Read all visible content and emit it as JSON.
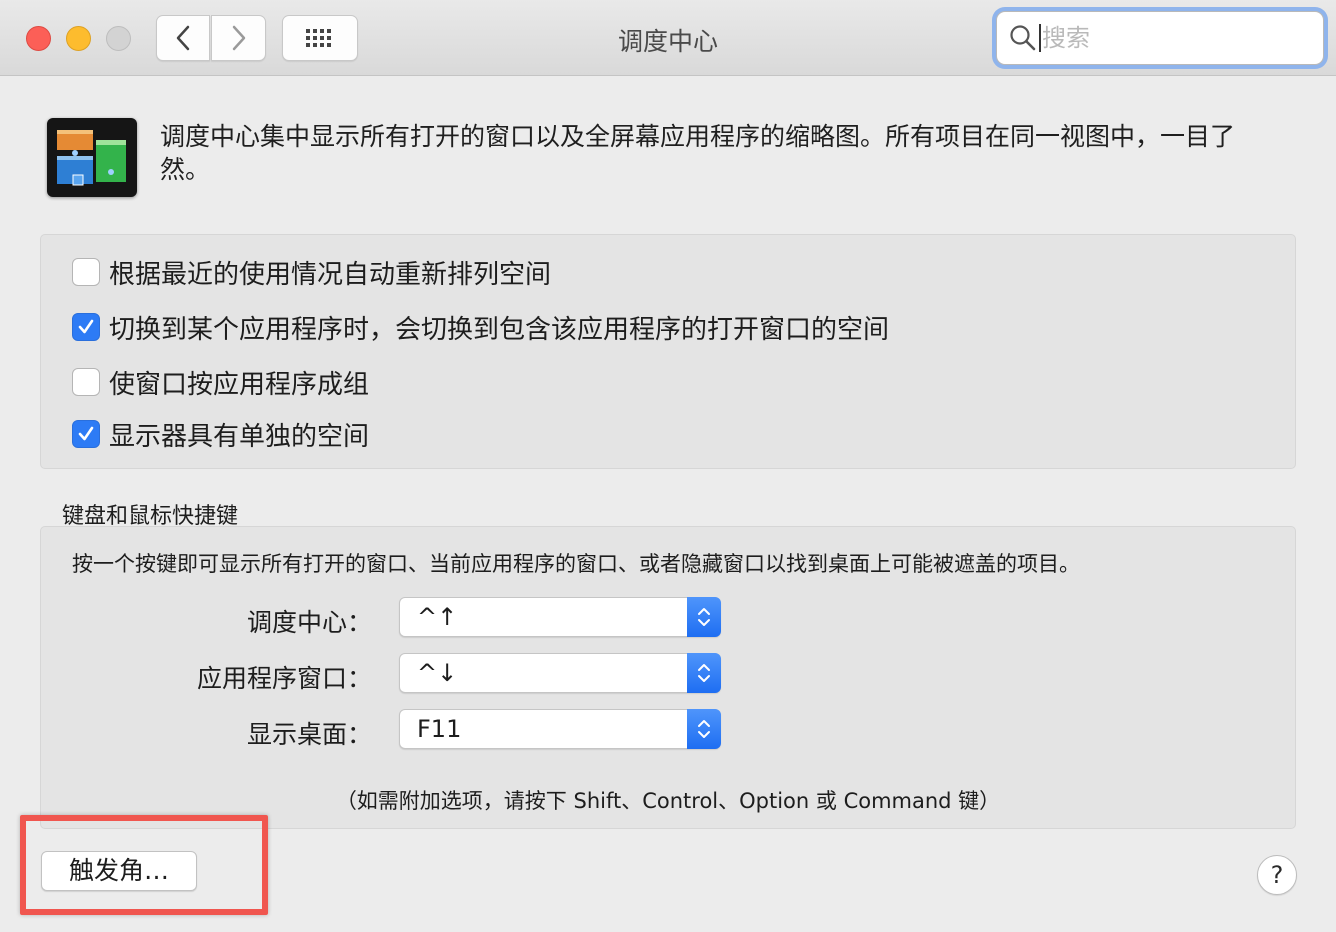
{
  "window": {
    "title": "调度中心",
    "search": {
      "value": "",
      "placeholder": "搜索"
    }
  },
  "header": {
    "description": "调度中心集中显示所有打开的窗口以及全屏幕应用程序的缩略图。所有项目在同一视图中，一目了然。"
  },
  "options": [
    {
      "label": "根据最近的使用情况自动重新排列空间",
      "checked": false
    },
    {
      "label": "切换到某个应用程序时，会切换到包含该应用程序的打开窗口的空间",
      "checked": true
    },
    {
      "label": "使窗口按应用程序成组",
      "checked": false
    },
    {
      "label": "显示器具有单独的空间",
      "checked": true
    }
  ],
  "shortcuts": {
    "section_title": "键盘和鼠标快捷键",
    "description": "按一个按键即可显示所有打开的窗口、当前应用程序的窗口、或者隐藏窗口以找到桌面上可能被遮盖的项目。",
    "rows": [
      {
        "label": "调度中心：",
        "value": "^↑"
      },
      {
        "label": "应用程序窗口：",
        "value": "^↓"
      },
      {
        "label": "显示桌面：",
        "value": "F11"
      }
    ],
    "hint": "（如需附加选项，请按下 Shift、Control、Option 或 Command 键）"
  },
  "footer": {
    "hot_corners_label": "触发角…",
    "help_label": "?"
  },
  "colors": {
    "accent": "#2d7bf5",
    "highlight_border": "#f0564f",
    "close": "#fc5f57",
    "minimize": "#fdbc2e"
  }
}
